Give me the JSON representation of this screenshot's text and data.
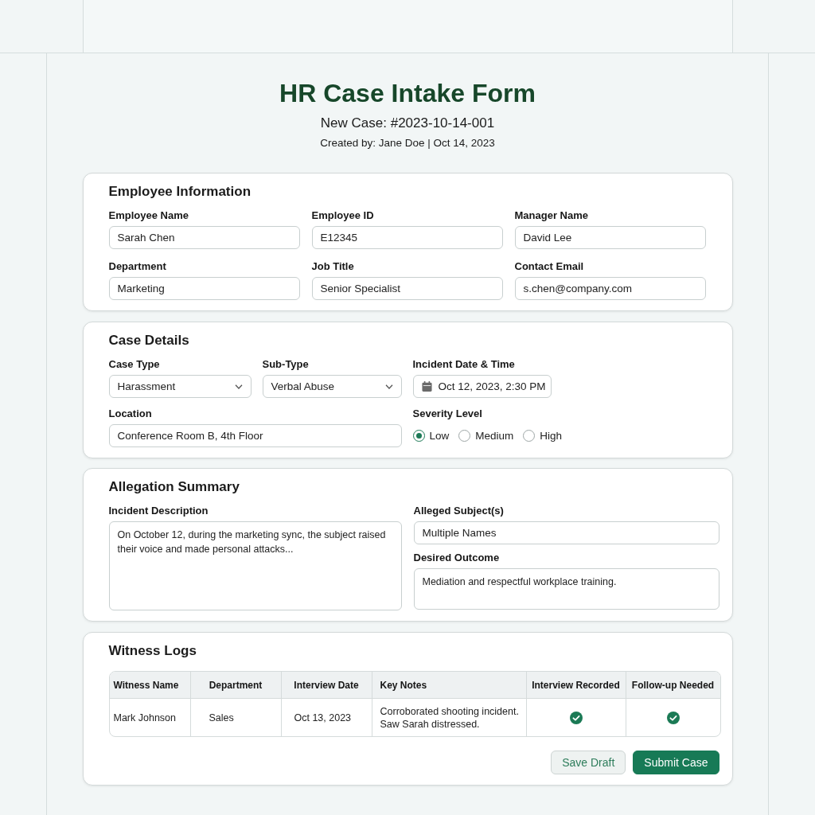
{
  "header": {
    "title": "HR Case Intake Form",
    "case_number": "New Case: #2023-10-14-001",
    "created": "Created by: Jane Doe | Oct 14, 2023"
  },
  "employee_information": {
    "title": "Employee Information",
    "fields": [
      {
        "label": "Employee Name",
        "value": "Sarah Chen"
      },
      {
        "label": "Employee ID",
        "value": "E12345"
      },
      {
        "label": "Manager Name",
        "value": "David Lee"
      },
      {
        "label": "Department",
        "value": "Marketing"
      },
      {
        "label": "Job Title",
        "value": "Senior Specialist"
      },
      {
        "label": "Contact Email",
        "value": "s.chen@company.com"
      }
    ]
  },
  "case_details": {
    "title": "Case Details",
    "fields": [
      {
        "kind": "select",
        "label": "Case Type",
        "value": "Harassment"
      },
      {
        "kind": "select",
        "label": "Sub-Type",
        "value": "Verbal Abuse"
      },
      {
        "kind": "date",
        "label": "Incident Date & Time",
        "value": "Oct 12, 2023, 2:30 PM"
      },
      {
        "kind": "text",
        "label": "Location",
        "value": "Conference Room B, 4th Floor"
      },
      {
        "kind": "radio",
        "label": "Severity Level",
        "options": [
          {
            "label": "Low",
            "selected": true
          },
          {
            "label": "Medium",
            "selected": false
          },
          {
            "label": "High",
            "selected": false
          }
        ]
      }
    ]
  },
  "allegation_summary": {
    "title": "Allegation Summary",
    "fields": [
      {
        "kind": "textarea",
        "label": "Incident Description",
        "value": "On October 12, during the marketing sync, the subject raised their voice and made personal attacks..."
      },
      {
        "kind": "text",
        "label": "Alleged Subject(s)",
        "value": "Multiple Names"
      },
      {
        "kind": "textarea",
        "label": "Desired Outcome",
        "value": "Mediation and respectful workplace training."
      }
    ]
  },
  "witness_logs": {
    "title": "Witness Logs",
    "columns": [
      "Witness Name",
      "Department",
      "Interview Date",
      "Key Notes",
      "Interview Recorded",
      "Follow-up Needed"
    ],
    "rows": [
      {
        "witness_name": "Mark Johnson",
        "department": "Sales",
        "interview_date": "Oct 13, 2023",
        "key_notes": "Corroborated shooting incident. Saw Sarah distressed.",
        "interview_recorded": true,
        "follow_up_needed": true
      }
    ]
  },
  "buttons": [
    {
      "kind": "secondary",
      "label": "Save Draft"
    },
    {
      "kind": "primary",
      "label": "Submit Case"
    }
  ]
}
